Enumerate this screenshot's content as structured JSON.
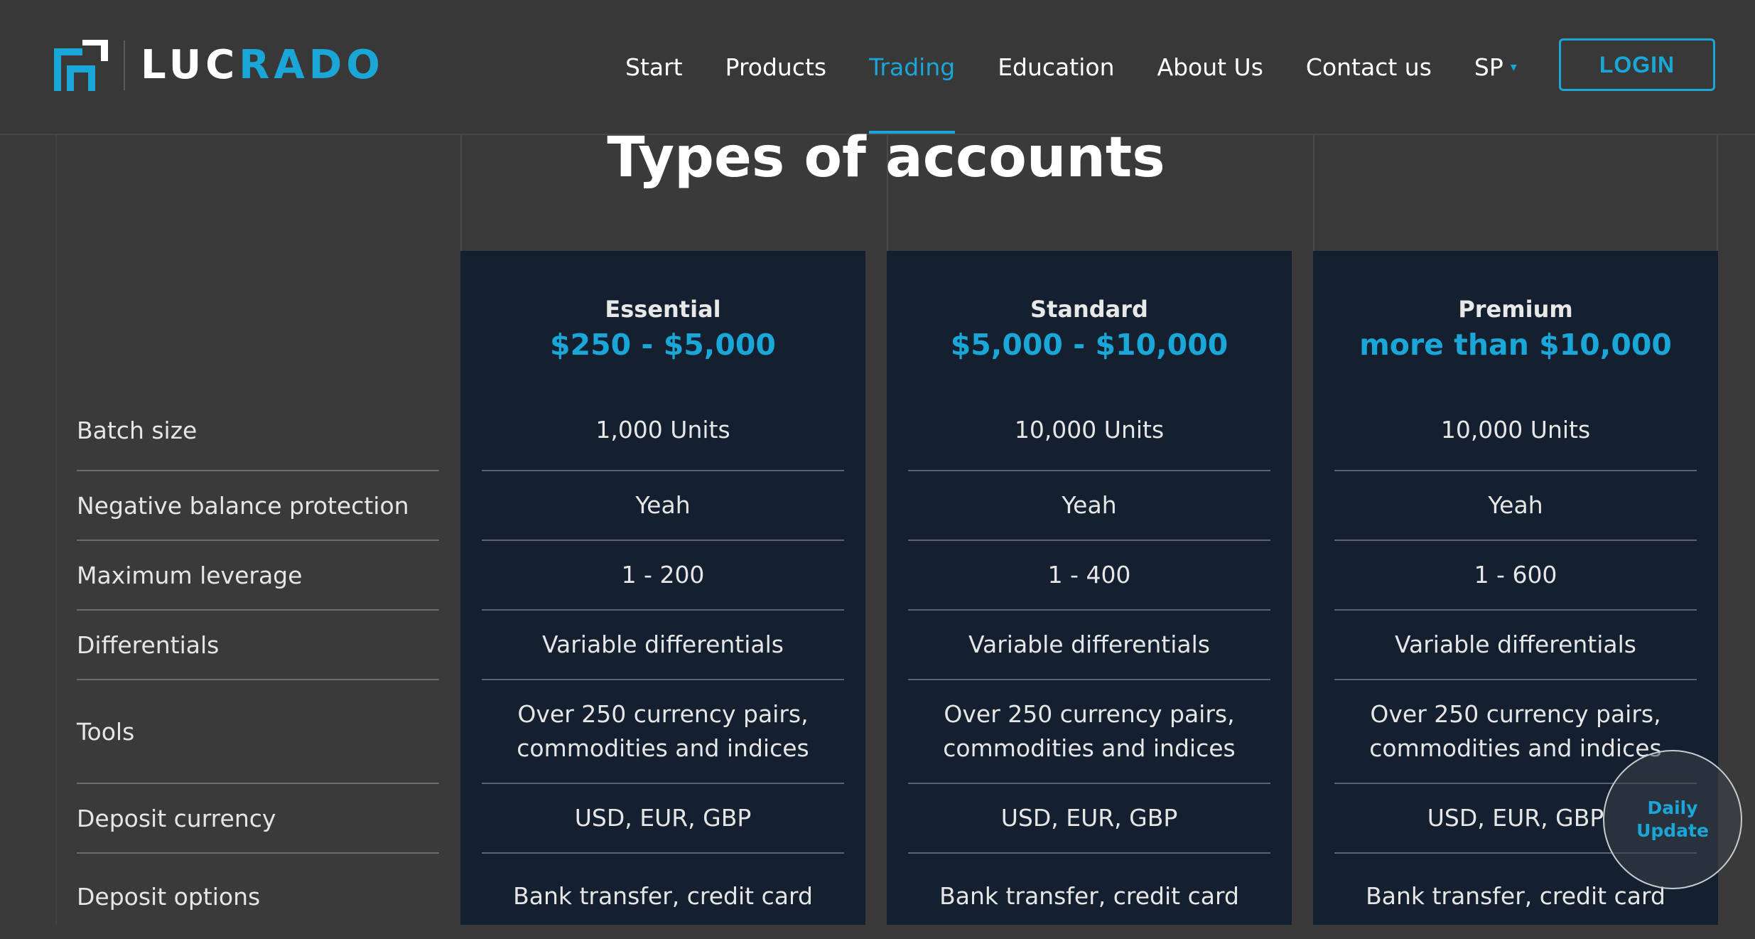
{
  "brand": {
    "name_white": "LUC",
    "name_blue": "RADO",
    "accent_color": "#1aa6d6"
  },
  "nav": {
    "items": [
      {
        "label": "Start"
      },
      {
        "label": "Products"
      },
      {
        "label": "Trading",
        "active": true
      },
      {
        "label": "Education"
      },
      {
        "label": "About Us"
      },
      {
        "label": "Contact us"
      }
    ],
    "language": "SP",
    "login_label": "LOGIN"
  },
  "page": {
    "title": "Types of accounts"
  },
  "plans": [
    {
      "name": "Essential",
      "range": "$250 - $5,000"
    },
    {
      "name": "Standard",
      "range": "$5,000 - $10,000"
    },
    {
      "name": "Premium",
      "range": "more than $10,000"
    }
  ],
  "rows": [
    {
      "label": "Batch size",
      "values": [
        "1,000 Units",
        "10,000 Units",
        "10,000 Units"
      ]
    },
    {
      "label": "Negative balance protection",
      "values": [
        "Yeah",
        "Yeah",
        "Yeah"
      ]
    },
    {
      "label": "Maximum leverage",
      "values": [
        "1 - 200",
        "1 - 400",
        "1 - 600"
      ]
    },
    {
      "label": "Differentials",
      "values": [
        "Variable differentials",
        "Variable differentials",
        "Variable differentials"
      ]
    },
    {
      "label": "Tools",
      "values": [
        [
          "Over 250 currency pairs,",
          "commodities and indices"
        ],
        [
          "Over 250 currency pairs,",
          "commodities and indices"
        ],
        [
          "Over 250 currency pairs,",
          "commodities and indices"
        ]
      ]
    },
    {
      "label": "Deposit currency",
      "values": [
        "USD, EUR, GBP",
        "USD, EUR, GBP",
        "USD, EUR, GBP"
      ]
    },
    {
      "label": "Deposit options",
      "values": [
        "Bank transfer, credit card",
        "Bank transfer, credit card",
        "Bank transfer, credit card"
      ]
    }
  ],
  "daily_update": {
    "line1": "Daily",
    "line2": "Update"
  }
}
